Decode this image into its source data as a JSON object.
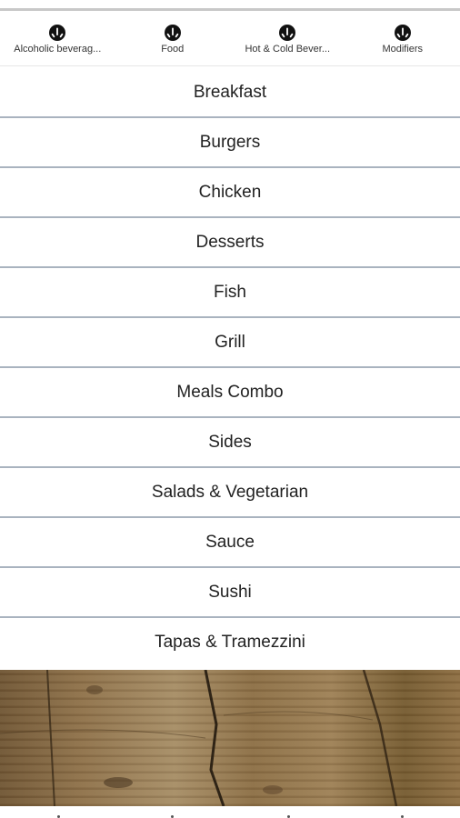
{
  "tabs": [
    {
      "label": "Alcoholic beverag...",
      "icon": "cutlery-badge-icon"
    },
    {
      "label": "Food",
      "icon": "cutlery-badge-icon"
    },
    {
      "label": "Hot & Cold Bever...",
      "icon": "cutlery-badge-icon"
    },
    {
      "label": "Modifiers",
      "icon": "cutlery-badge-icon"
    }
  ],
  "categories": [
    "Breakfast",
    "Burgers",
    "Chicken",
    "Desserts",
    "Fish",
    "Grill",
    "Meals Combo",
    "Sides",
    "Salads & Vegetarian",
    "Sauce",
    "Sushi",
    "Tapas & Tramezzini"
  ],
  "colors": {
    "separator": "#a9b3bf",
    "text": "#222222",
    "icon": "#111111"
  }
}
